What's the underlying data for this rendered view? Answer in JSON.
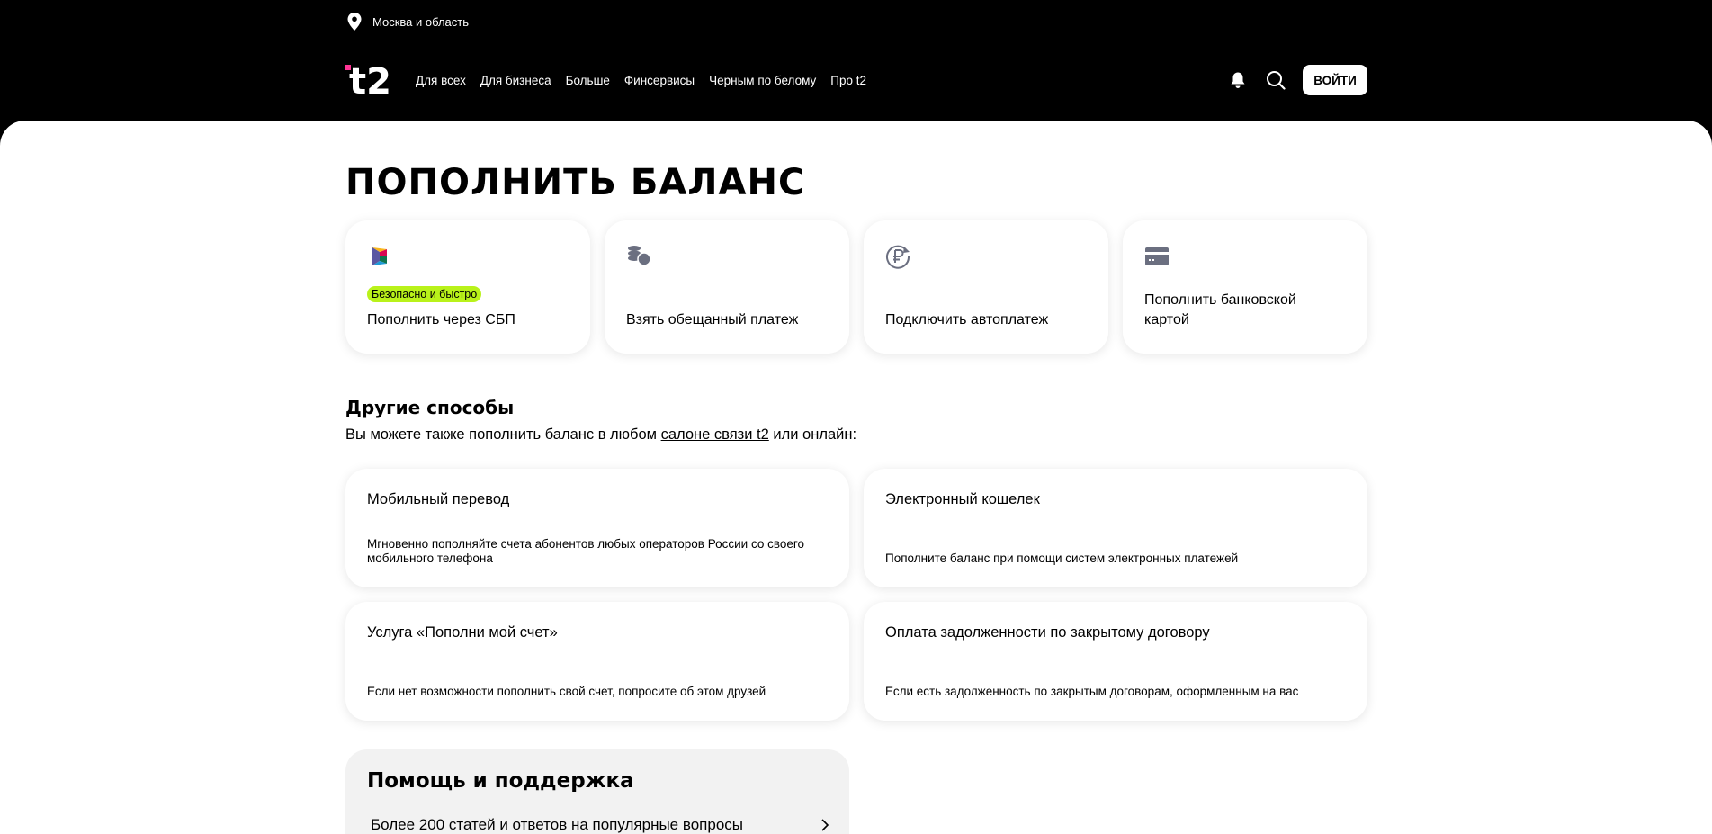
{
  "region": {
    "label": "Москва и область",
    "icon": "location-pin-icon"
  },
  "brand": {
    "logo_text": "t2",
    "accent": "#ff3495"
  },
  "nav": {
    "links": [
      "Для всех",
      "Для бизнеса",
      "Больше",
      "Финсервисы",
      "Черным по белому",
      "Про t2"
    ],
    "login_label": "ВОЙТИ"
  },
  "page": {
    "title": "ПОПОЛНИТЬ БАЛАНС"
  },
  "top_cards": [
    {
      "icon": "sbp-icon",
      "badge": "Безопасно и быстро",
      "label": "Пополнить через СБП"
    },
    {
      "icon": "coins-icon",
      "label": "Взять обещанный платеж"
    },
    {
      "icon": "ruble-autopay-icon",
      "label": "Подключить автоплатеж"
    },
    {
      "icon": "bank-card-icon",
      "label": "Пополнить банковской картой"
    }
  ],
  "other": {
    "title": "Другие способы",
    "text_before": "Вы можете также пополнить баланс в любом ",
    "link": "салоне связи t2",
    "text_after": " или онлайн:"
  },
  "method_cards": [
    {
      "title": "Мобильный перевод",
      "desc": "Мгновенно пополняйте счета абонентов любых операторов России со своего мобильного телефона"
    },
    {
      "title": "Электронный кошелек",
      "desc": "Пополните баланс при помощи систем электронных платежей"
    },
    {
      "title": "Услуга «Пополни мой счет»",
      "desc": "Если нет возможности пополнить свой счет, попросите об этом друзей"
    },
    {
      "title": "Оплата задолженности по закрытому договору",
      "desc": "Если есть задолженность по закрытым договорам, оформленным на вас"
    }
  ],
  "help": {
    "title": "Помощь и поддержка",
    "link": "Более 200 статей и ответов на популярные вопросы"
  },
  "colors": {
    "badge": "#b9f21a",
    "help_bg": "#f2f2f2",
    "header_bg": "#000000"
  }
}
